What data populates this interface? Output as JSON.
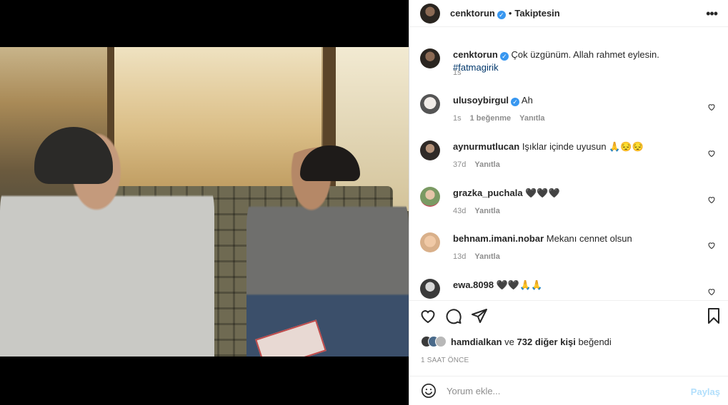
{
  "header": {
    "username": "cenktorun",
    "status": "Takiptesin",
    "more_icon": "more-horizontal-icon"
  },
  "caption": {
    "username": "cenktorun",
    "text": "Çok üzgünüm. Allah rahmet eylesin.",
    "hashtag": "#fatmagirik",
    "time": "1s"
  },
  "comments": [
    {
      "username": "ulusoybirgul",
      "verified": true,
      "text": "Ah",
      "time": "1s",
      "likes": "1 beğenme",
      "reply": "Yanıtla"
    },
    {
      "username": "aynurmutlucan",
      "verified": false,
      "text": "Işıklar içinde uyusun 🙏😔😔",
      "time": "37d",
      "reply": "Yanıtla"
    },
    {
      "username": "grazka_puchala",
      "verified": false,
      "text": "🖤🖤🖤",
      "time": "43d",
      "reply": "Yanıtla"
    },
    {
      "username": "behnam.imani.nobar",
      "verified": false,
      "text": "Mekanı cennet olsun",
      "time": "13d",
      "reply": "Yanıtla"
    },
    {
      "username": "ewa.8098",
      "verified": false,
      "text": "🖤🖤🙏🙏"
    }
  ],
  "likes": {
    "first": "hamdialkan",
    "connector": "ve",
    "others": "732 diğer kişi",
    "suffix": "beğendi"
  },
  "post_time": "1 SAAT ÖNCE",
  "add_comment": {
    "placeholder": "Yorum ekle...",
    "post_label": "Paylaş"
  },
  "colors": {
    "verified": "#3897f0",
    "hashtag": "#00376b",
    "post_disabled": "#b2dffc",
    "muted": "#8e8e8e"
  }
}
